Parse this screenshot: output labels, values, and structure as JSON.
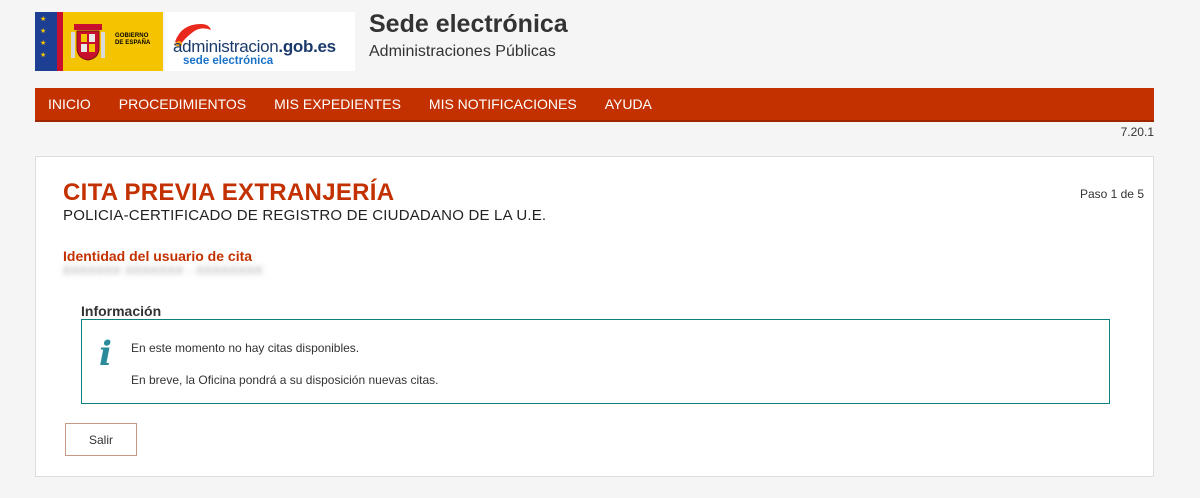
{
  "header": {
    "gov_logo_text": [
      "GOBIERNO",
      "DE ESPAÑA"
    ],
    "adm_logo_name": "administracion",
    "adm_logo_domain": ".gob.es",
    "adm_logo_sub": "sede electrónica",
    "title": "Sede electrónica",
    "subtitle": "Administraciones Públicas"
  },
  "nav": {
    "items": [
      "INICIO",
      "PROCEDIMIENTOS",
      "MIS EXPEDIENTES",
      "MIS NOTIFICACIONES",
      "AYUDA"
    ]
  },
  "version": "7.20.1",
  "main": {
    "title": "CITA PREVIA EXTRANJERÍA",
    "subtitle": "POLICIA-CERTIFICADO DE REGISTRO DE CIUDADANO DE LA U.E.",
    "step": "Paso 1 de 5",
    "identity_label": "Identidad del usuario de cita",
    "info_heading": "Información",
    "info_icon": "i",
    "messages": [
      "En este momento no hay citas disponibles.",
      "En breve, la Oficina pondrá a su disposición nuevas citas."
    ],
    "exit_button": "Salir"
  },
  "colors": {
    "brand": "#c33100",
    "info_border": "#0b7f82",
    "info_icon": "#2a8c9a"
  }
}
